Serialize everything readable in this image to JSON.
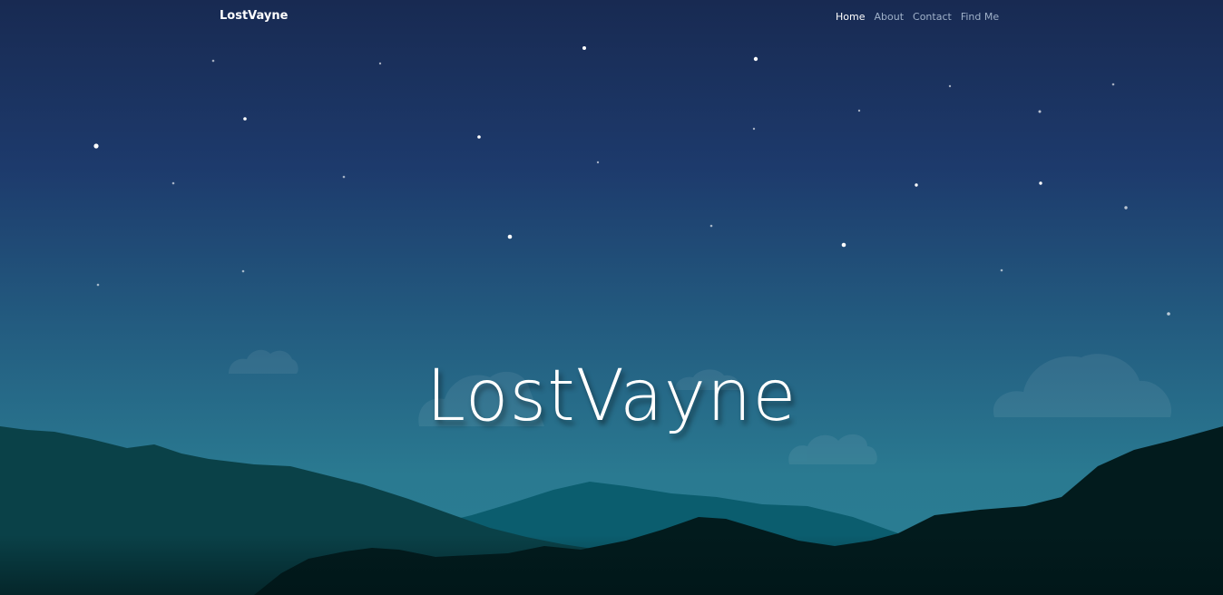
{
  "header": {
    "brand": "LostVayne",
    "nav": [
      {
        "label": "Home",
        "active": true
      },
      {
        "label": "About",
        "active": false
      },
      {
        "label": "Contact",
        "active": false
      },
      {
        "label": "Find Me",
        "active": false
      }
    ]
  },
  "hero": {
    "title": "LostVayne"
  },
  "colors": {
    "sky_top": "#182a52",
    "sky_bottom": "#2a7f93",
    "mountain_back": "#0b5d6e",
    "mountain_mid": "#0a4148",
    "mountain_front": "#021b1d",
    "star": "#ffffff"
  }
}
